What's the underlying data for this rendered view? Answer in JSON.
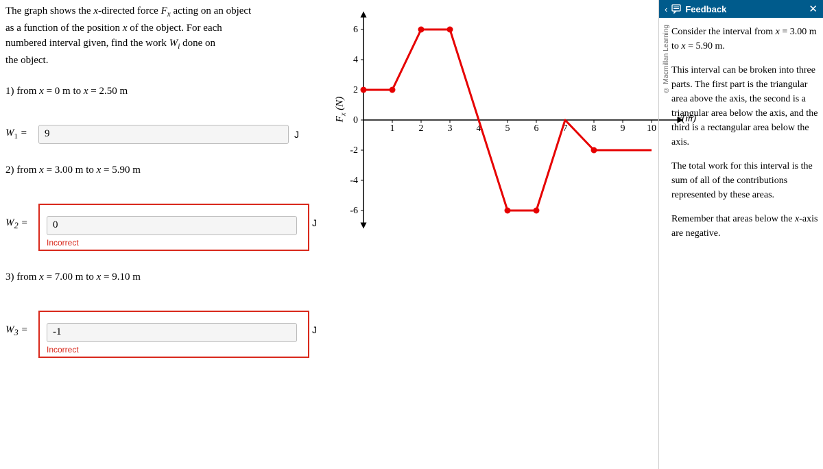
{
  "intro": {
    "line1_a": "The graph shows the ",
    "line1_b": "-directed force ",
    "line1_c": " acting on an object",
    "line2_a": "as a function of the position ",
    "line2_b": " of the object. For each",
    "line3_a": "numbered interval given, find the work ",
    "line3_b": " done on",
    "line4": "the object.",
    "var_x": "x",
    "var_Fx": "F",
    "var_Fx_sub": "x",
    "var_Wi": "W",
    "var_Wi_sub": "i"
  },
  "q1": {
    "label_a": "1) from ",
    "label_b": " = 0 m to ",
    "label_c": " = 2.50 m",
    "lhs": "W",
    "sub": "1",
    "eq": " =",
    "value": "9",
    "unit": "J"
  },
  "q2": {
    "label_a": "2) from ",
    "label_b": " = 3.00 m to ",
    "label_c": " = 5.90 m",
    "lhs": "W",
    "sub": "2",
    "eq": " =",
    "value": "0",
    "unit": "J",
    "incorrect": "Incorrect"
  },
  "q3": {
    "label_a": "3) from ",
    "label_b": " = 7.00 m to ",
    "label_c": " = 9.10 m",
    "lhs": "W",
    "sub": "3",
    "eq": " =",
    "value": "-1",
    "unit": "J",
    "incorrect": "Incorrect"
  },
  "graph": {
    "ylabel": "F  (N)",
    "ylabel_sub": "x",
    "xlabel": "x(m)",
    "yTicks": [
      "6",
      "4",
      "2",
      "0",
      "-2",
      "-4",
      "-6"
    ],
    "xTicks": [
      "1",
      "2",
      "3",
      "4",
      "5",
      "6",
      "7",
      "8",
      "9",
      "10"
    ]
  },
  "feedback": {
    "header": "Feedback",
    "p1_a": "Consider the interval from ",
    "p1_b": " = 3.00 m to ",
    "p1_c": " = 5.90 m.",
    "p2": "This interval can be broken into three parts. The first part is the triangular area above the axis, the second is a triangular area below the axis, and the third is a rectangular area below the axis.",
    "p3": "The total work for this interval is the sum of all of the contributions represented by these areas.",
    "p4_a": "Remember that areas below the ",
    "p4_b": "-axis are negative.",
    "copyright": "© Macmillan Learning"
  },
  "chart_data": {
    "type": "line",
    "title": "",
    "xlabel": "x(m)",
    "ylabel": "Fx (N)",
    "xlim": [
      0,
      11
    ],
    "ylim": [
      -7,
      7
    ],
    "series": [
      {
        "name": "Fx",
        "points": [
          {
            "x": 0,
            "y": 2
          },
          {
            "x": 1,
            "y": 2
          },
          {
            "x": 2,
            "y": 6
          },
          {
            "x": 3,
            "y": 6
          },
          {
            "x": 4,
            "y": 0
          },
          {
            "x": 5,
            "y": -6
          },
          {
            "x": 6,
            "y": -6
          },
          {
            "x": 7,
            "y": 0
          },
          {
            "x": 8,
            "y": -2
          },
          {
            "x": 10,
            "y": -2
          }
        ],
        "dots_at": [
          0,
          1,
          2,
          3,
          5,
          6,
          8,
          10
        ]
      }
    ]
  }
}
